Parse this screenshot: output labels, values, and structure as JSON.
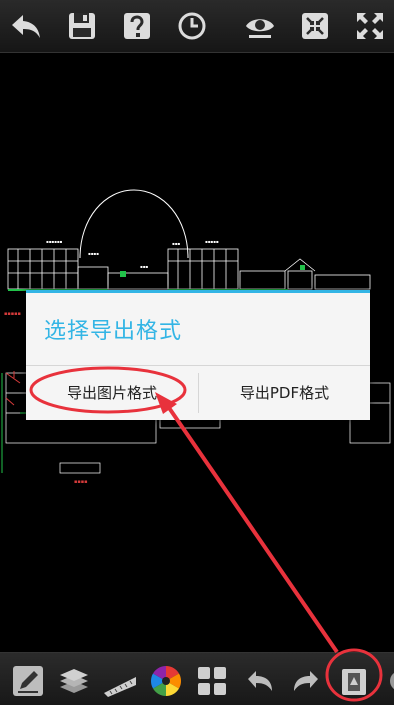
{
  "toolbar_top": {
    "buttons": [
      {
        "name": "back-icon"
      },
      {
        "name": "save-icon"
      },
      {
        "name": "help-icon"
      },
      {
        "name": "clock-icon"
      },
      {
        "name": "eye-icon"
      },
      {
        "name": "fit-screen-icon"
      },
      {
        "name": "fullscreen-icon"
      }
    ]
  },
  "dialog": {
    "title": "选择导出格式",
    "btn_image": "导出图片格式",
    "btn_pdf": "导出PDF格式"
  },
  "toolbar_bottom": {
    "buttons": [
      {
        "name": "edit-icon"
      },
      {
        "name": "layers-icon"
      },
      {
        "name": "measure-icon"
      },
      {
        "name": "color-wheel-icon"
      },
      {
        "name": "layout-icon"
      },
      {
        "name": "undo-icon"
      },
      {
        "name": "redo-icon"
      },
      {
        "name": "export-icon"
      }
    ]
  },
  "colors": {
    "accent": "#33b5e5",
    "annotation": "#e8323c",
    "cad_line": "#ffffff",
    "cad_green": "#22c24a",
    "cad_red": "#d63b3b"
  }
}
